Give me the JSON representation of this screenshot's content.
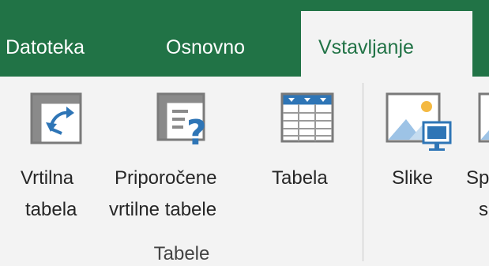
{
  "tabs": [
    {
      "label": "Datoteka",
      "active": false
    },
    {
      "label": "Osnovno",
      "active": false
    },
    {
      "label": "Vstavljanje",
      "active": true
    }
  ],
  "ribbon": {
    "groups": [
      {
        "label": "Tabele",
        "buttons": [
          {
            "line1": "Vrtilna",
            "line2": "tabela",
            "icon": "pivot-table-icon"
          },
          {
            "line1": "Priporočene",
            "line2": "vrtilne tabele",
            "icon": "recommended-pivot-icon"
          },
          {
            "line1": "Tabela",
            "line2": "",
            "icon": "table-icon"
          }
        ]
      },
      {
        "label": "",
        "buttons": [
          {
            "line1": "Slike",
            "line2": "",
            "icon": "pictures-icon"
          },
          {
            "line1": "Sp",
            "line2": "s",
            "icon": "online-pictures-icon"
          }
        ]
      }
    ]
  },
  "colors": {
    "accent": "#217346",
    "icon_blue": "#2e75b6"
  }
}
